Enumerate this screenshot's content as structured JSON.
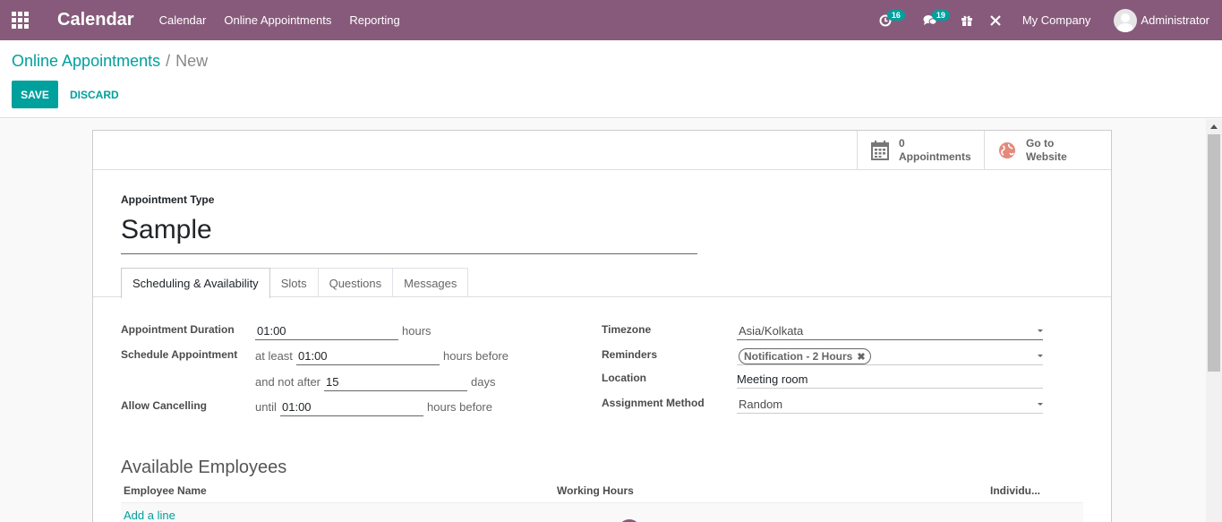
{
  "navbar": {
    "brand": "Calendar",
    "menu": [
      "Calendar",
      "Online Appointments",
      "Reporting"
    ],
    "activity_count": "16",
    "messages_count": "19",
    "company": "My Company",
    "user": "Administrator",
    "icons": [
      "apps-icon",
      "clock-icon",
      "chat-icon",
      "gift-icon",
      "debug-icon",
      "avatar"
    ],
    "color": "#875a7b"
  },
  "breadcrumb": {
    "parent": "Online Appointments",
    "separator": "/",
    "current": "New"
  },
  "actions": {
    "save": "SAVE",
    "discard": "DISCARD",
    "accent": "#00a09d"
  },
  "smart_buttons": {
    "appointments": {
      "count": "0",
      "label": "Appointments",
      "icon": "calendar-icon"
    },
    "website": {
      "line1": "Go to",
      "line2": "Website",
      "icon": "globe-icon"
    }
  },
  "form": {
    "type_label": "Appointment Type",
    "type_name": "Sample",
    "tabs": [
      "Scheduling & Availability",
      "Slots",
      "Questions",
      "Messages"
    ],
    "active_tab": "Scheduling & Availability",
    "left": {
      "duration_label": "Appointment Duration",
      "duration_value": "01:00",
      "duration_unit": "hours",
      "schedule_label": "Schedule Appointment",
      "at_least_text": "at least",
      "at_least_value": "01:00",
      "at_least_unit": "hours before",
      "not_after_text": "and not after",
      "not_after_value": "15",
      "not_after_unit": "days",
      "cancel_label": "Allow Cancelling",
      "until_text": "until",
      "until_value": "01:00",
      "until_unit": "hours before"
    },
    "right": {
      "timezone_label": "Timezone",
      "timezone_value": "Asia/Kolkata",
      "reminders_label": "Reminders",
      "reminder_tag": "Notification - 2 Hours",
      "location_label": "Location",
      "location_value": "Meeting room",
      "assignment_label": "Assignment Method",
      "assignment_value": "Random"
    },
    "employees": {
      "title": "Available Employees",
      "columns": [
        "Employee Name",
        "Working Hours",
        "Individu..."
      ],
      "add_line": "Add a line"
    }
  }
}
